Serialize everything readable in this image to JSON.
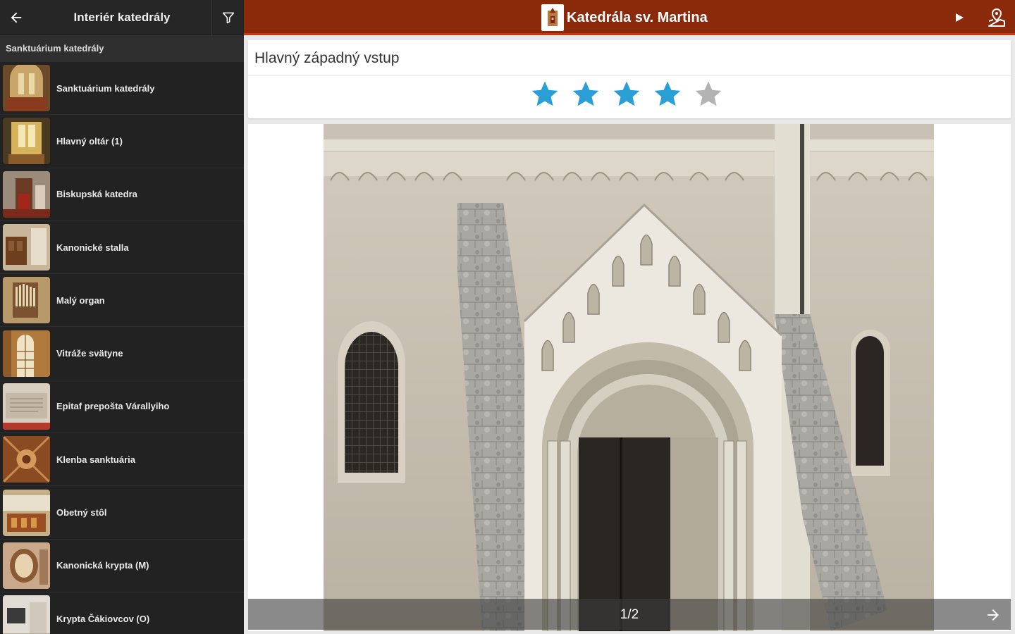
{
  "sidebar": {
    "title": "Interiér katedrály",
    "section": "Sanktuárium katedrály",
    "items": [
      {
        "label": "Sanktuárium katedrály",
        "thumb": "sanctuary"
      },
      {
        "label": "Hlavný oltár (1)",
        "thumb": "altar"
      },
      {
        "label": "Biskupská katedra",
        "thumb": "chair"
      },
      {
        "label": "Kanonické stalla",
        "thumb": "stalls"
      },
      {
        "label": "Malý organ",
        "thumb": "organ"
      },
      {
        "label": "Vitráže svätyne",
        "thumb": "window"
      },
      {
        "label": "Epitaf prepošta Várallyiho",
        "thumb": "epitaph"
      },
      {
        "label": "Klenba sanktuária",
        "thumb": "vault"
      },
      {
        "label": "Obetný stôl",
        "thumb": "table"
      },
      {
        "label": "Kanonická krypta (M)",
        "thumb": "crypt"
      },
      {
        "label": "Krypta Čákiovcov (O)",
        "thumb": "crypt2"
      }
    ]
  },
  "header": {
    "title": "Katedrála sv. Martina",
    "accent": "#8b2a0a"
  },
  "detail": {
    "title": "Hlavný západný vstup",
    "rating": 4,
    "max_rating": 5,
    "star_color": "#2a9fd6",
    "star_empty_color": "#b3b3b3",
    "pager": "1/2"
  },
  "icons": {
    "back": "back-arrow-icon",
    "filter": "filter-icon",
    "play": "play-icon",
    "navigate": "navigation-icon",
    "next": "next-arrow-icon"
  }
}
